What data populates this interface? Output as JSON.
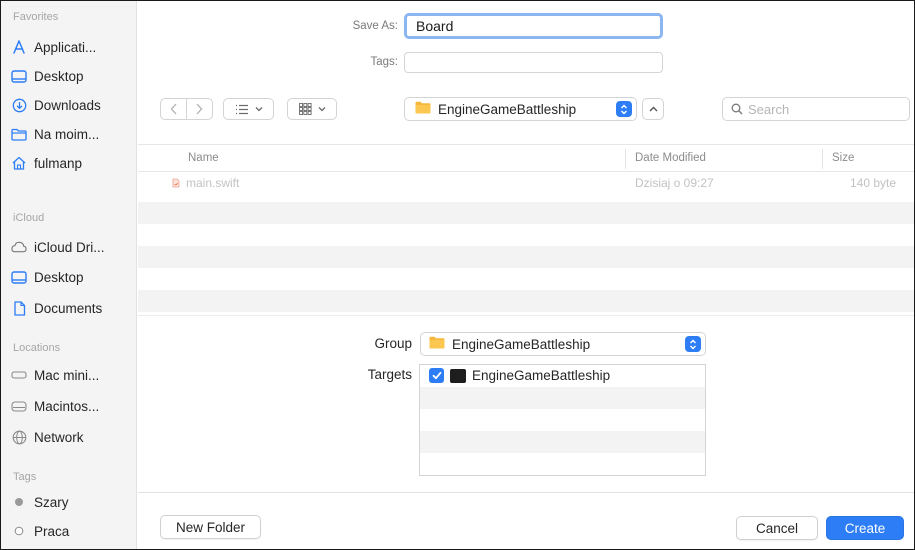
{
  "colors": {
    "accent": "#2c7df6",
    "folder": "#f5b73c"
  },
  "sidebar": {
    "favorites_title": "Favorites",
    "favorites": [
      {
        "label": "Applicati...",
        "icon": "applications-icon"
      },
      {
        "label": "Desktop",
        "icon": "desktop-icon"
      },
      {
        "label": "Downloads",
        "icon": "downloads-icon"
      },
      {
        "label": "Na moim...",
        "icon": "folder-icon"
      },
      {
        "label": "fulmanp",
        "icon": "home-icon"
      }
    ],
    "icloud_title": "iCloud",
    "icloud": [
      {
        "label": "iCloud Dri...",
        "icon": "cloud-icon"
      },
      {
        "label": "Desktop",
        "icon": "desktop-icon"
      },
      {
        "label": "Documents",
        "icon": "document-icon"
      }
    ],
    "locations_title": "Locations",
    "locations": [
      {
        "label": "Mac mini...",
        "icon": "computer-icon"
      },
      {
        "label": "Macintos...",
        "icon": "disk-icon"
      },
      {
        "label": "Network",
        "icon": "network-icon"
      }
    ],
    "tags_title": "Tags",
    "tags": [
      {
        "label": "Szary",
        "icon": "tag-dot-gray-icon",
        "color": "#9a9a9a"
      },
      {
        "label": "Praca",
        "icon": "tag-dot-empty-icon",
        "color": "#ffffff"
      }
    ]
  },
  "form": {
    "save_as_label": "Save As:",
    "save_as_value": "Board",
    "tags_label": "Tags:",
    "tags_value": ""
  },
  "toolbar": {
    "location": "EngineGameBattleship",
    "search_placeholder": "Search"
  },
  "filelist": {
    "columns": {
      "name": "Name",
      "date": "Date Modified",
      "size": "Size"
    },
    "rows": [
      {
        "name": "main.swift",
        "date": "Dzisiaj o 09:27",
        "size": "140 byte"
      }
    ]
  },
  "options": {
    "group_label": "Group",
    "group_value": "EngineGameBattleship",
    "targets_label": "Targets",
    "targets": [
      {
        "name": "EngineGameBattleship",
        "checked": true
      }
    ]
  },
  "buttons": {
    "new_folder": "New Folder",
    "cancel": "Cancel",
    "create": "Create"
  }
}
